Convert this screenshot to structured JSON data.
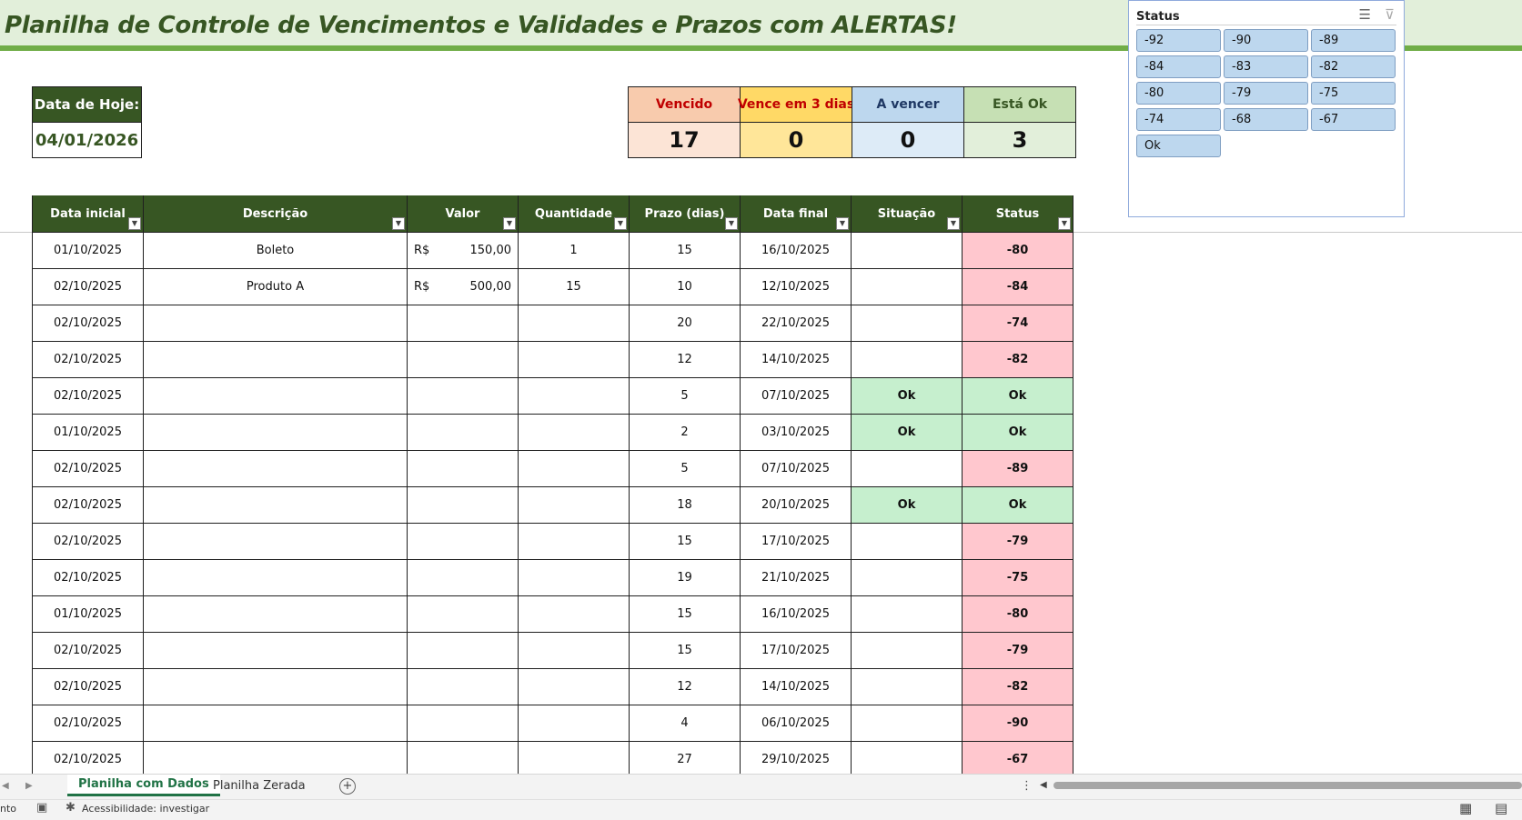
{
  "title": "Planilha de Controle de Vencimentos e Validades e Prazos com ALERTAS!",
  "today": {
    "label": "Data de Hoje:",
    "value": "04/01/2026"
  },
  "summary": [
    {
      "label": "Vencido",
      "value": "17",
      "header_bg": "#f8cbad",
      "header_color": "#c00000",
      "value_bg": "#fce4d6"
    },
    {
      "label": "Vence em 3 dias",
      "value": "0",
      "header_bg": "#ffd966",
      "header_color": "#c00000",
      "value_bg": "#ffe699"
    },
    {
      "label": "A vencer",
      "value": "0",
      "header_bg": "#bdd7ee",
      "header_color": "#1f3864",
      "value_bg": "#ddebf7"
    },
    {
      "label": "Está Ok",
      "value": "3",
      "header_bg": "#c6e0b4",
      "header_color": "#375623",
      "value_bg": "#e2efda"
    }
  ],
  "slicer": {
    "title": "Status",
    "items": [
      "-92",
      "-90",
      "-89",
      "-84",
      "-83",
      "-82",
      "-80",
      "-79",
      "-75",
      "-74",
      "-68",
      "-67",
      "Ok"
    ]
  },
  "table": {
    "headers": [
      "Data inicial",
      "Descrição",
      "Valor",
      "Quantidade",
      "Prazo (dias)",
      "Data final",
      "Situação",
      "Status"
    ],
    "rows": [
      {
        "data_inicial": "01/10/2025",
        "descricao": "Boleto",
        "moeda": "R$",
        "valor": "150,00",
        "quantidade": "1",
        "prazo": "15",
        "data_final": "16/10/2025",
        "situacao": "",
        "status": "-80",
        "status_type": "neg"
      },
      {
        "data_inicial": "02/10/2025",
        "descricao": "Produto A",
        "moeda": "R$",
        "valor": "500,00",
        "quantidade": "15",
        "prazo": "10",
        "data_final": "12/10/2025",
        "situacao": "",
        "status": "-84",
        "status_type": "neg"
      },
      {
        "data_inicial": "02/10/2025",
        "descricao": "",
        "moeda": "",
        "valor": "",
        "quantidade": "",
        "prazo": "20",
        "data_final": "22/10/2025",
        "situacao": "",
        "status": "-74",
        "status_type": "neg"
      },
      {
        "data_inicial": "02/10/2025",
        "descricao": "",
        "moeda": "",
        "valor": "",
        "quantidade": "",
        "prazo": "12",
        "data_final": "14/10/2025",
        "situacao": "",
        "status": "-82",
        "status_type": "neg"
      },
      {
        "data_inicial": "02/10/2025",
        "descricao": "",
        "moeda": "",
        "valor": "",
        "quantidade": "",
        "prazo": "5",
        "data_final": "07/10/2025",
        "situacao": "Ok",
        "status": "Ok",
        "status_type": "ok"
      },
      {
        "data_inicial": "01/10/2025",
        "descricao": "",
        "moeda": "",
        "valor": "",
        "quantidade": "",
        "prazo": "2",
        "data_final": "03/10/2025",
        "situacao": "Ok",
        "status": "Ok",
        "status_type": "ok"
      },
      {
        "data_inicial": "02/10/2025",
        "descricao": "",
        "moeda": "",
        "valor": "",
        "quantidade": "",
        "prazo": "5",
        "data_final": "07/10/2025",
        "situacao": "",
        "status": "-89",
        "status_type": "neg"
      },
      {
        "data_inicial": "02/10/2025",
        "descricao": "",
        "moeda": "",
        "valor": "",
        "quantidade": "",
        "prazo": "18",
        "data_final": "20/10/2025",
        "situacao": "Ok",
        "status": "Ok",
        "status_type": "ok"
      },
      {
        "data_inicial": "02/10/2025",
        "descricao": "",
        "moeda": "",
        "valor": "",
        "quantidade": "",
        "prazo": "15",
        "data_final": "17/10/2025",
        "situacao": "",
        "status": "-79",
        "status_type": "neg"
      },
      {
        "data_inicial": "02/10/2025",
        "descricao": "",
        "moeda": "",
        "valor": "",
        "quantidade": "",
        "prazo": "19",
        "data_final": "21/10/2025",
        "situacao": "",
        "status": "-75",
        "status_type": "neg"
      },
      {
        "data_inicial": "01/10/2025",
        "descricao": "",
        "moeda": "",
        "valor": "",
        "quantidade": "",
        "prazo": "15",
        "data_final": "16/10/2025",
        "situacao": "",
        "status": "-80",
        "status_type": "neg"
      },
      {
        "data_inicial": "02/10/2025",
        "descricao": "",
        "moeda": "",
        "valor": "",
        "quantidade": "",
        "prazo": "15",
        "data_final": "17/10/2025",
        "situacao": "",
        "status": "-79",
        "status_type": "neg"
      },
      {
        "data_inicial": "02/10/2025",
        "descricao": "",
        "moeda": "",
        "valor": "",
        "quantidade": "",
        "prazo": "12",
        "data_final": "14/10/2025",
        "situacao": "",
        "status": "-82",
        "status_type": "neg"
      },
      {
        "data_inicial": "02/10/2025",
        "descricao": "",
        "moeda": "",
        "valor": "",
        "quantidade": "",
        "prazo": "4",
        "data_final": "06/10/2025",
        "situacao": "",
        "status": "-90",
        "status_type": "neg"
      },
      {
        "data_inicial": "02/10/2025",
        "descricao": "",
        "moeda": "",
        "valor": "",
        "quantidade": "",
        "prazo": "27",
        "data_final": "29/10/2025",
        "situacao": "",
        "status": "-67",
        "status_type": "neg"
      }
    ]
  },
  "sheet_tabs": [
    {
      "label": "Planilha com Dados",
      "active": true
    },
    {
      "label": "Planilha Zerada",
      "active": false
    }
  ],
  "statusbar": {
    "mode": "nto",
    "accessibility": "Acessibilidade: investigar"
  },
  "icons": {
    "multiselect": "multi-select-icon",
    "clear_filter": "clear-filter-icon",
    "dropdown": "filter-dropdown-icon",
    "add_sheet": "add-sheet-icon",
    "normal_view": "normal-view-icon",
    "page_layout": "page-layout-icon"
  },
  "colors": {
    "header_green": "#375623",
    "accent_green": "#70ad47",
    "title_bg": "#e2efda",
    "negative_bg": "#ffc7ce",
    "negative_text": "#9c0006",
    "ok_bg": "#c6efce",
    "ok_text": "#006100",
    "slicer_button": "#bdd7ee"
  }
}
